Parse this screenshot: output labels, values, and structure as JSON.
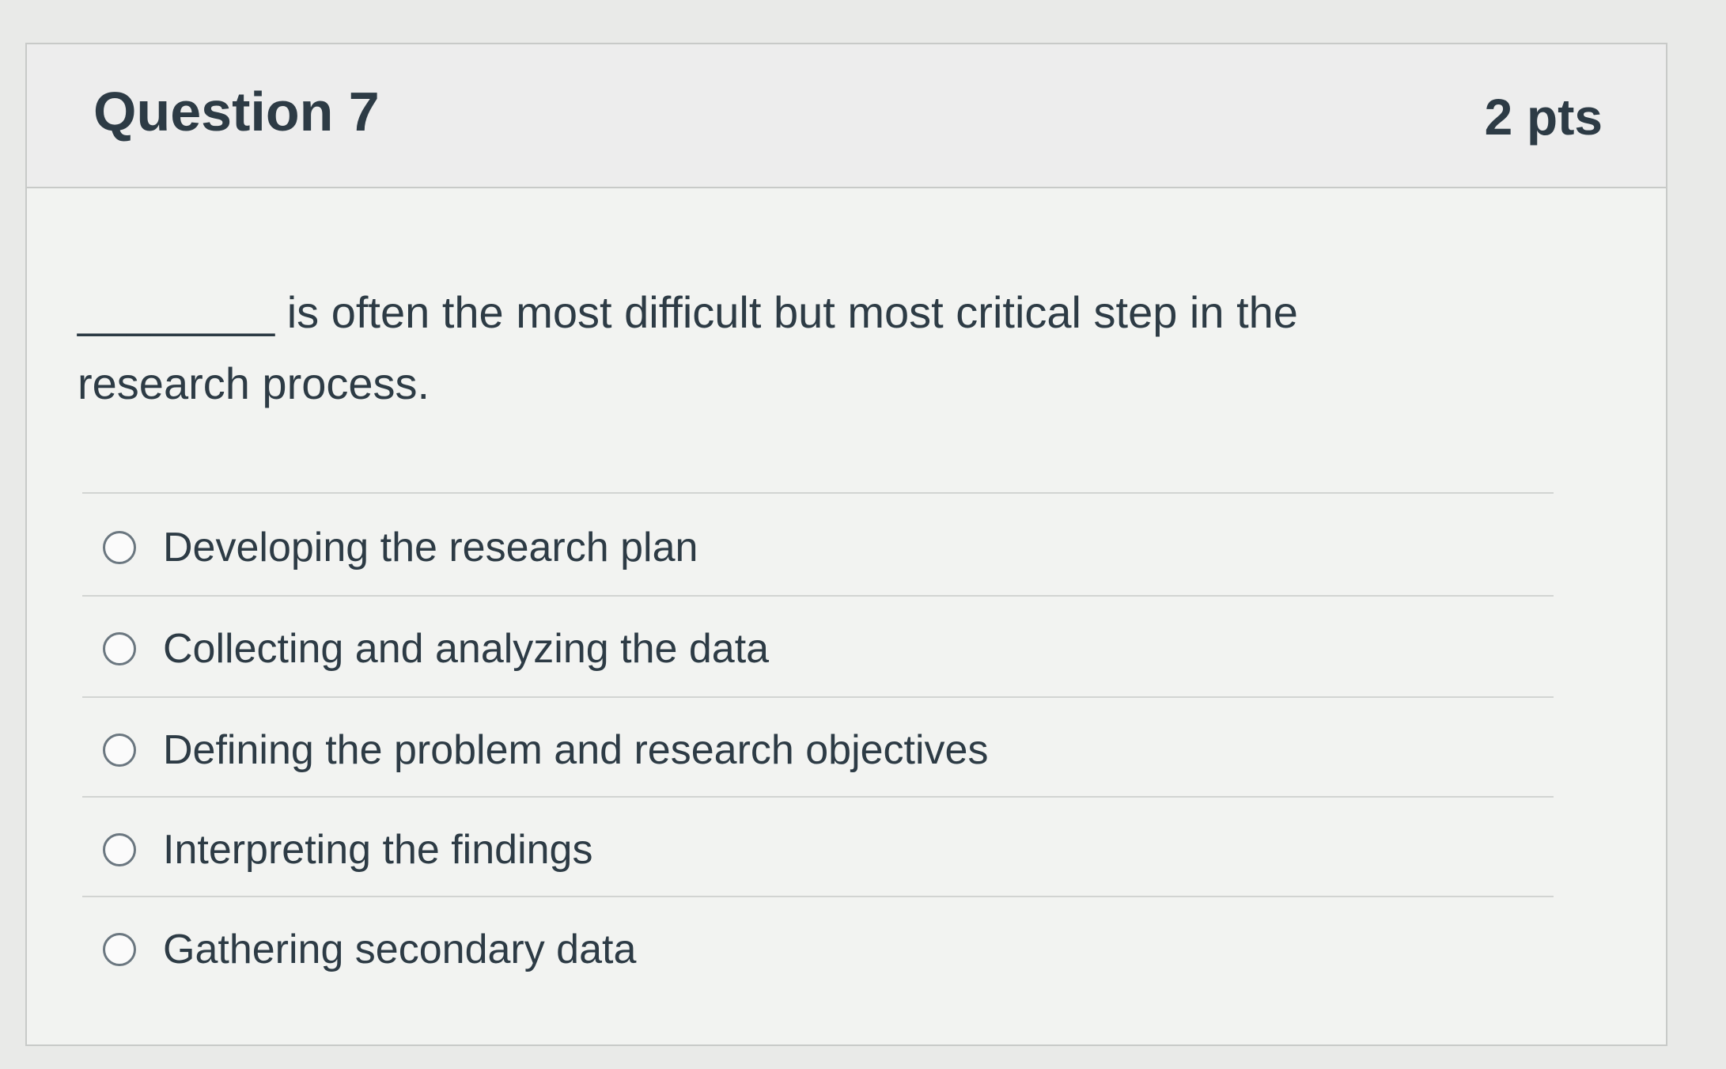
{
  "question": {
    "title": "Question 7",
    "points": "2 pts",
    "text_line1": "________ is often the most difficult but most critical step in the",
    "text_line2": "research process."
  },
  "answers": [
    {
      "label": "Developing the research plan",
      "selected": false
    },
    {
      "label": "Collecting and analyzing the data",
      "selected": false
    },
    {
      "label": "Defining the problem and research objectives",
      "selected": false
    },
    {
      "label": "Interpreting the findings",
      "selected": false
    },
    {
      "label": "Gathering secondary data",
      "selected": false
    }
  ],
  "colors": {
    "text": "#2d3b45",
    "header_bg": "#ededed",
    "card_bg": "#f2f3f1",
    "border": "#c8cac8"
  }
}
